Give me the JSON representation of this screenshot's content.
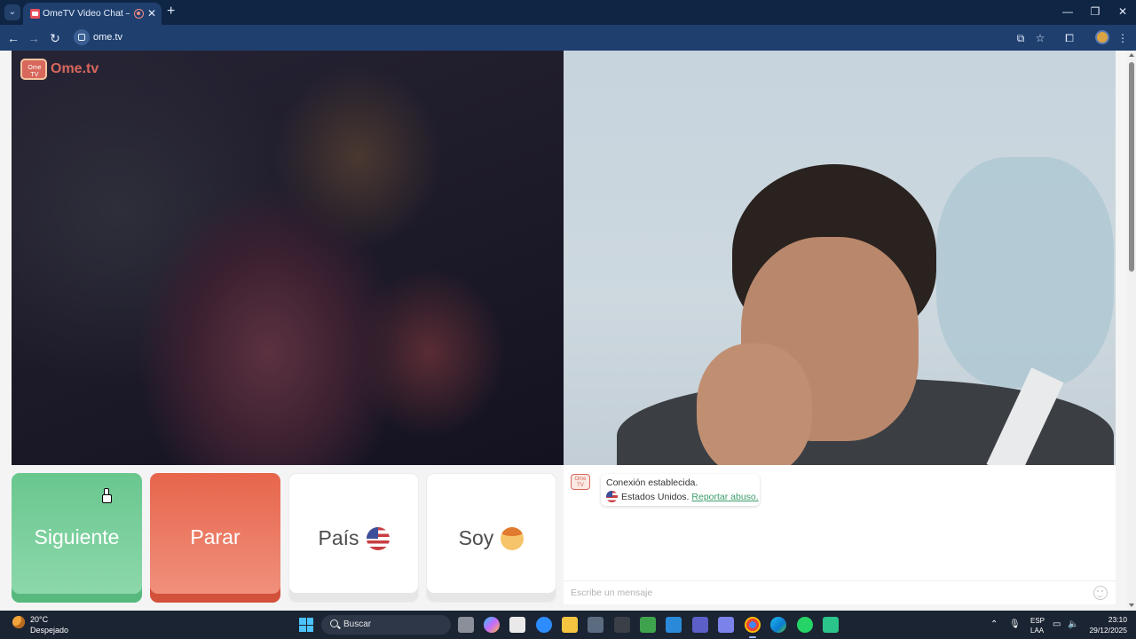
{
  "browser": {
    "tab_title": "OmeTV Video Chat — Omegle",
    "url": "ome.tv",
    "new_tab_symbol": "+",
    "tab_close_symbol": "✕",
    "minimize_symbol": "—",
    "restore_symbol": "❐",
    "close_symbol": "✕"
  },
  "site": {
    "logo_text": "Ome.tv"
  },
  "controls": {
    "next_label": "Siguiente",
    "stop_label": "Parar",
    "country_label": "País",
    "country_flag_icon": "us-flag-icon",
    "iam_label": "Soy",
    "iam_avatar_icon": "boy-avatar-icon"
  },
  "chat": {
    "message_connected": "Conexión establecida.",
    "country_text": "Estados Unidos.",
    "report_link": "Reportar abuso.",
    "input_placeholder": "Escribe un mensaje"
  },
  "taskbar": {
    "weather_temp": "20°C",
    "weather_desc": "Despejado",
    "search_label": "Buscar",
    "lang_top": "ESP",
    "lang_bottom": "LAA",
    "time": "23:10",
    "date": "29/12/2025"
  },
  "colors": {
    "next_button": "#69c78e",
    "stop_button": "#e7654c",
    "brand": "#d8675c",
    "link": "#3a9c6a",
    "titlebar": "#0f2544",
    "toolbar": "#1f3f6e"
  }
}
